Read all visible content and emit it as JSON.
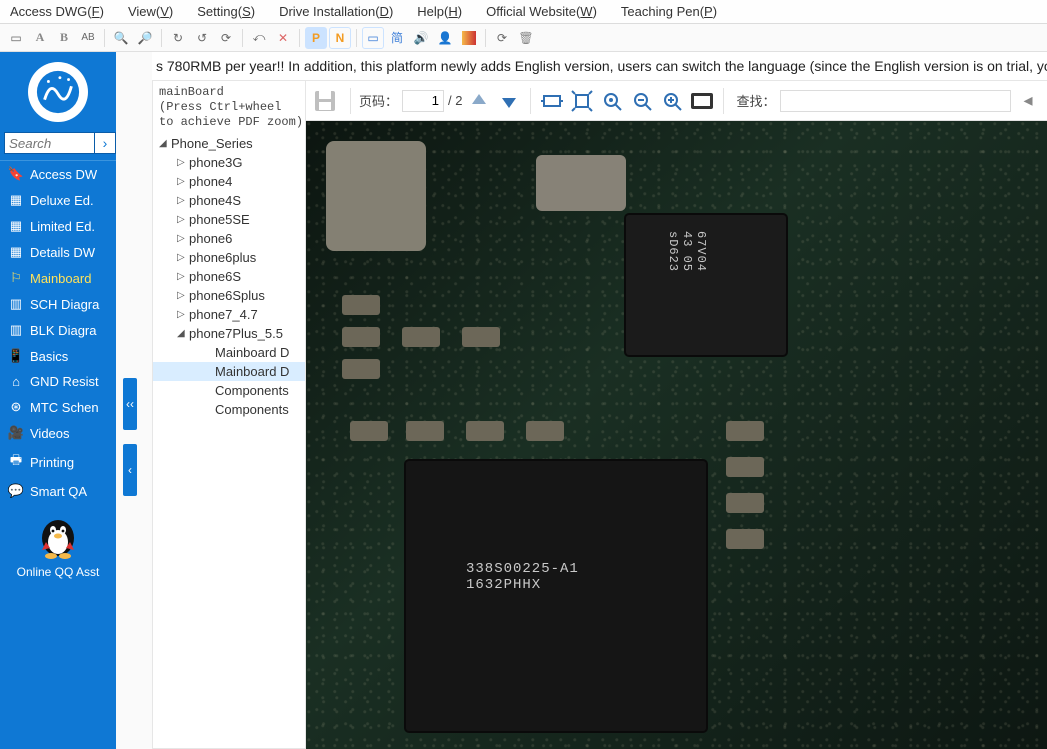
{
  "menu": [
    {
      "label": "Access DWG",
      "key": "F"
    },
    {
      "label": "View",
      "key": "V"
    },
    {
      "label": "Setting",
      "key": "S"
    },
    {
      "label": "Drive Installation",
      "key": "D"
    },
    {
      "label": "Help",
      "key": "H"
    },
    {
      "label": "Official Website",
      "key": "W"
    },
    {
      "label": "Teaching Pen",
      "key": "P"
    }
  ],
  "toolbar_text": {
    "A": "A",
    "B": "B",
    "AB": "AB",
    "P": "P",
    "N": "N",
    "jian": "简"
  },
  "banner": "s 780RMB per year!! In addition, this platform newly adds English version, users can switch the language (since the English version is on trial, you",
  "search": {
    "placeholder": "Search"
  },
  "nav": [
    {
      "label": "Access DW",
      "icon": "bookmark"
    },
    {
      "label": "Deluxe Ed.",
      "icon": "grid"
    },
    {
      "label": "Limited Ed.",
      "icon": "grid"
    },
    {
      "label": "Details DW",
      "icon": "grid"
    },
    {
      "label": "Mainboard",
      "icon": "flag",
      "active": true
    },
    {
      "label": "SCH Diagra",
      "icon": "box"
    },
    {
      "label": "BLK Diagra",
      "icon": "box"
    },
    {
      "label": "Basics",
      "icon": "phone"
    },
    {
      "label": "GND Resist",
      "icon": "chip"
    },
    {
      "label": "MTC Schen",
      "icon": "sun"
    },
    {
      "label": "Videos",
      "icon": "video"
    },
    {
      "label": "Printing",
      "icon": "print"
    },
    {
      "label": "Smart QA",
      "icon": "chat"
    }
  ],
  "qq": {
    "label": "Online QQ Asst"
  },
  "handles": {
    "one": "‹‹",
    "two": "‹"
  },
  "tree": {
    "header": "mainBoard\n(Press Ctrl+wheel\nto achieve PDF zoom)",
    "root": {
      "label": "Phone_Series"
    },
    "items": [
      {
        "label": "phone3G"
      },
      {
        "label": "phone4"
      },
      {
        "label": "phone4S"
      },
      {
        "label": "phone5SE"
      },
      {
        "label": "phone6"
      },
      {
        "label": "phone6plus"
      },
      {
        "label": "phone6S"
      },
      {
        "label": "phone6Splus"
      },
      {
        "label": "phone7_4.7"
      }
    ],
    "expanded": {
      "label": "phone7Plus_5.5"
    },
    "leaves": [
      {
        "label": "Mainboard D"
      },
      {
        "label": "Mainboard D",
        "selected": true
      },
      {
        "label": "Components"
      },
      {
        "label": "Components"
      }
    ]
  },
  "pdf": {
    "page_label": "页码：",
    "page_current": "1",
    "page_sep": "/ 2",
    "find_label": "查找：",
    "find_value": ""
  },
  "chip_text": {
    "main": "338S00225-A1\n1632PHHX",
    "small": "67V04\n43 05\nsD623"
  }
}
